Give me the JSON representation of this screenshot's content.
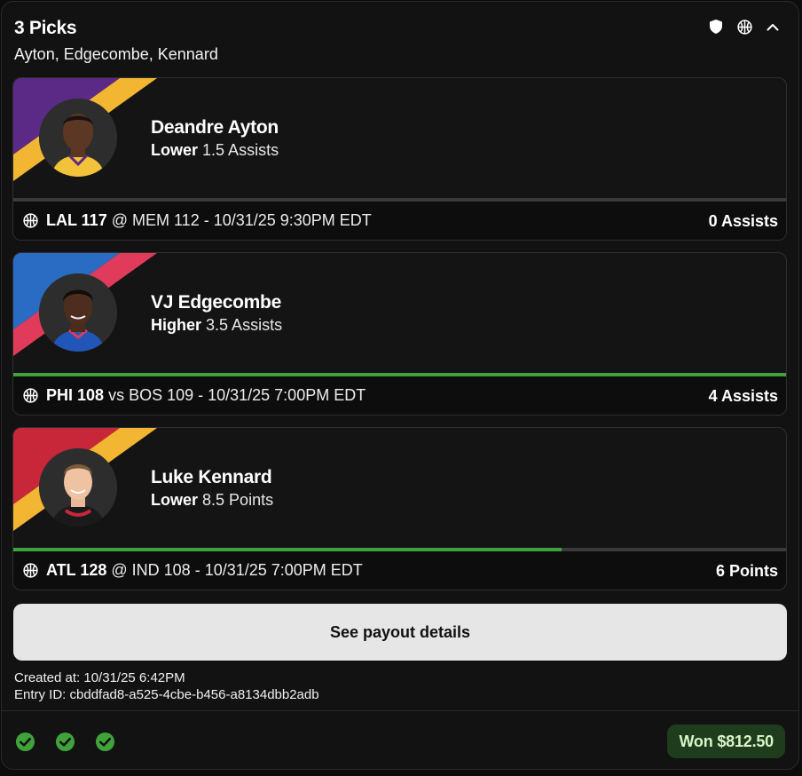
{
  "header": {
    "title": "3 Picks",
    "subtitle": "Ayton, Edgecombe, Kennard"
  },
  "icons": {
    "shield": "shield-icon",
    "basketball": "basketball-icon",
    "collapse": "chevron-up-icon"
  },
  "picks": [
    {
      "player": "Deandre Ayton",
      "direction": "Lower",
      "line": "1.5 Assists",
      "team": "LAL 117",
      "matchup": "@ MEM 112 - 10/31/25 9:30PM EDT",
      "result": "0 Assists",
      "progress": 0,
      "colors": [
        "#5b2a86",
        "#f2b632"
      ]
    },
    {
      "player": "VJ Edgecombe",
      "direction": "Higher",
      "line": "3.5 Assists",
      "team": "PHI 108",
      "matchup": "vs BOS 109 - 10/31/25 7:00PM EDT",
      "result": "4 Assists",
      "progress": 1,
      "colors": [
        "#2a6bc4",
        "#e03b5a"
      ]
    },
    {
      "player": "Luke Kennard",
      "direction": "Lower",
      "line": "8.5 Points",
      "team": "ATL 128",
      "matchup": "@ IND 108 - 10/31/25 7:00PM EDT",
      "result": "6 Points",
      "progress": 0.71,
      "colors": [
        "#c8273a",
        "#f2b632"
      ]
    }
  ],
  "payout_button": "See payout details",
  "meta": {
    "created": "Created at: 10/31/25 6:42PM",
    "entry_id": "Entry ID: cbddfad8-a525-4cbe-b456-a8134dbb2adb"
  },
  "footer": {
    "check_count": 3,
    "won": "Won $812.50"
  },
  "colors": {
    "accent_green": "#3fa23a",
    "won_bg": "#1f3d1d"
  }
}
